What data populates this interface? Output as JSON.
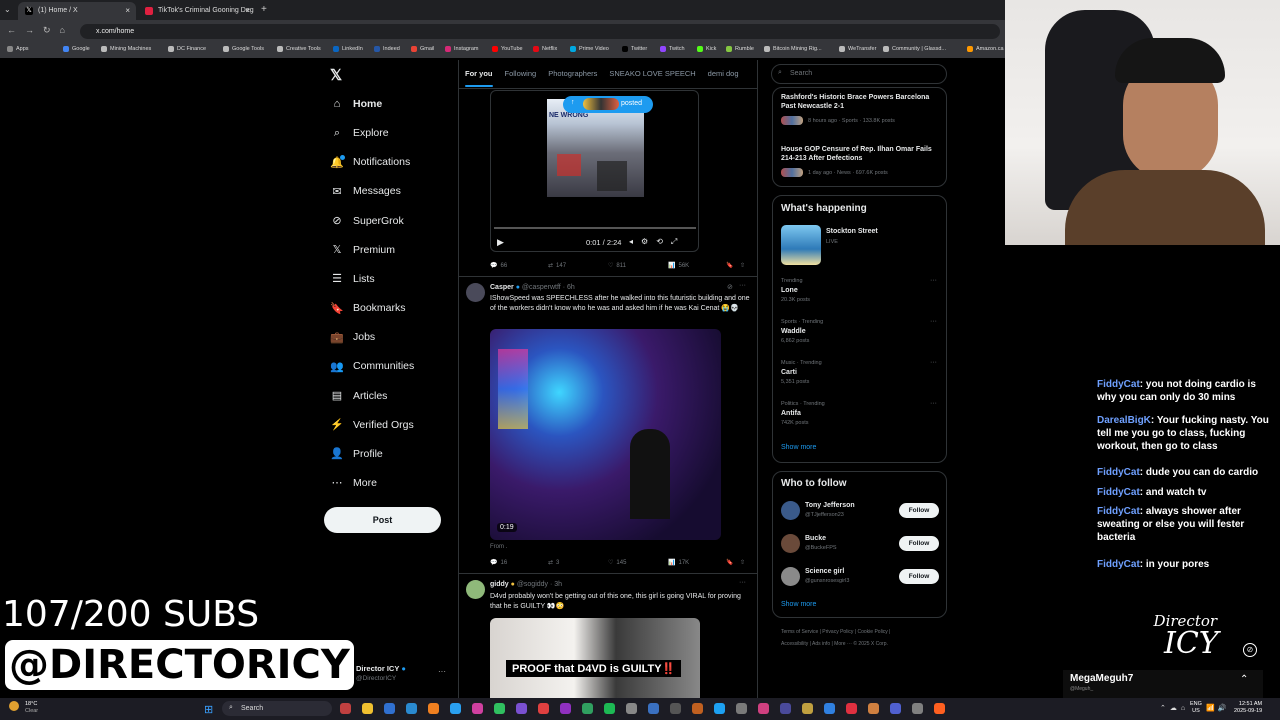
{
  "browser": {
    "tabs": [
      {
        "title": "(1) Home / X"
      },
      {
        "title": "TikTok's Criminal Gooning Deg"
      }
    ],
    "url": "x.com/home",
    "bookmarks": [
      "Apps",
      "Google",
      "Mining Machines",
      "DC Finance",
      "Google Tools",
      "Creative Tools",
      "LinkedIn",
      "Indeed",
      "Gmail",
      "Instagram",
      "YouTube",
      "Netflix",
      "Prime Video",
      "Twitter",
      "Twitch",
      "Kick",
      "Rumble",
      "Bitcoin Mining Rig...",
      "WeTransfer",
      "Community | Glassd...",
      "Amazon.ca"
    ]
  },
  "nav": {
    "items": [
      "Home",
      "Explore",
      "Notifications",
      "Messages",
      "SuperGrok",
      "Premium",
      "Lists",
      "Bookmarks",
      "Jobs",
      "Communities",
      "Articles",
      "Verified Orgs",
      "Profile",
      "More"
    ],
    "post": "Post",
    "account_name": "Director ICY",
    "account_handle": "@DirectorICY",
    "account_more": "···"
  },
  "feed": {
    "tabs": [
      "For you",
      "Following",
      "Photographers",
      "SNEAKO LOVE SPEECH",
      "demi dog"
    ],
    "video1": {
      "posted": "posted",
      "time": "0:01 / 2:24",
      "thumb_text": "NE WRONG",
      "stats": [
        "66",
        "147",
        "811",
        "56K"
      ]
    },
    "tweet2": {
      "name": "Casper",
      "handle": "@casperwtff · 6h",
      "text": "IShowSpeed was SPEECHLESS after he walked into this futuristic building and one of the workers didn't know who he was and asked him if he was Kai Cenat 😭💀",
      "duration": "0:19",
      "from": "From .",
      "stats": [
        "16",
        "3",
        "145",
        "17K"
      ]
    },
    "tweet3": {
      "name": "giddy",
      "handle": "@sogiddy · 3h",
      "text": "D4vd probably won't be getting out of this one, this girl is going VIRAL for proving that he is GUILTY 👀😳",
      "caption": "PROOF that D4VD is GUILTY‼️"
    }
  },
  "sidebar": {
    "search": "Search",
    "news": [
      {
        "title": "Rashford's Historic Brace Powers Barcelona Past Newcastle 2-1",
        "meta": "8 hours ago · Sports · 133.8K posts"
      },
      {
        "title": "House GOP Censure of Rep. Ilhan Omar Fails 214-213 After Defections",
        "meta": "1 day ago · News · 697.6K posts"
      }
    ],
    "happening_title": "What's happening",
    "live": {
      "name": "Stockton Street",
      "status": "LIVE"
    },
    "trends": [
      {
        "cat": "Trending",
        "name": "Lone",
        "posts": "20.3K posts"
      },
      {
        "cat": "Sports · Trending",
        "name": "Waddle",
        "posts": "6,862 posts"
      },
      {
        "cat": "Music · Trending",
        "name": "Carti",
        "posts": "5,351 posts"
      },
      {
        "cat": "Politics · Trending",
        "name": "Antifa",
        "posts": "742K posts"
      }
    ],
    "show_more": "Show more",
    "wtf_title": "Who to follow",
    "follow": [
      {
        "name": "Tony Jefferson",
        "handle": "@TJjefferson23"
      },
      {
        "name": "Bucke",
        "handle": "@BuckeFPS"
      },
      {
        "name": "Science girl",
        "handle": "@gunsnrosesgirl3"
      }
    ],
    "follow_label": "Follow",
    "footer1": "Terms of Service  |  Privacy Policy  |  Cookie Policy  |",
    "footer2": "Accessibility  |  Ads info  |  More ···  © 2025 X Corp."
  },
  "overlay": {
    "subs": "107/200 SUBS",
    "handle": "@DIRECTORICY",
    "logo_top": "Director",
    "logo_bottom": "ICY",
    "chat_user": "MegaMeguh7",
    "chat_sub": "@Meguh_"
  },
  "chat": [
    {
      "user": "FiddyCat",
      "msg": ": you not doing cardio is why you can only do 30 mins"
    },
    {
      "user": "DarealBigK",
      "msg": ": Your fucking nasty. You tell me you go to class, fucking workout, then go to class"
    },
    {
      "user": "FiddyCat",
      "msg": ": dude you can do cardio"
    },
    {
      "user": "FiddyCat",
      "msg": ": and watch tv"
    },
    {
      "user": "FiddyCat",
      "msg": ": always shower after sweating or else you will fester bacteria"
    },
    {
      "user": "FiddyCat",
      "msg": ": in your pores"
    }
  ],
  "taskbar": {
    "temp": "18°C",
    "weather": "Clear",
    "search": "Search",
    "lang1": "ENG",
    "lang2": "US",
    "time": "12:51 AM",
    "date": "2025-09-19"
  }
}
